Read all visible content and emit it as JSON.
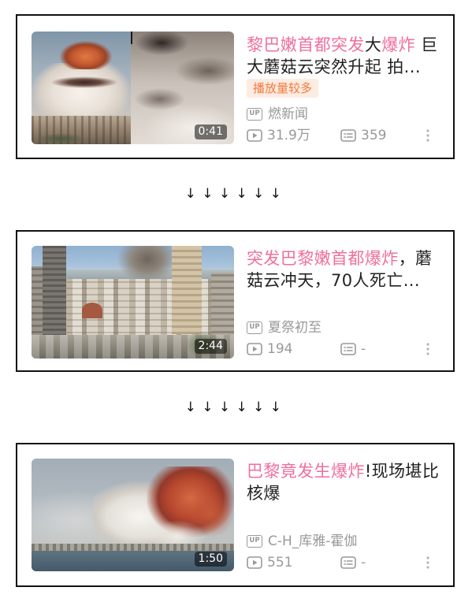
{
  "colors": {
    "background": "#ffffff",
    "card_border": "#111111",
    "title_text": "#222222",
    "keyword_highlight": "#ef6f9d",
    "meta_text": "#999999",
    "badge_text": "#f27a3e",
    "badge_background": "#fdece2"
  },
  "labels": {
    "up": "UP"
  },
  "connector": {
    "glyph": "↓",
    "icon": "down-arrow-icon"
  },
  "icons": {
    "uploader": "up-badge-icon",
    "views": "play-count-icon",
    "danmaku": "danmaku-count-icon",
    "more": "more-options-icon"
  },
  "cards": [
    {
      "title_lines": [
        [
          {
            "text": "黎巴嫩首都突发",
            "hl": true
          },
          {
            "text": "大",
            "hl": false
          },
          {
            "text": "爆炸",
            "hl": true
          },
          {
            "text": " 巨",
            "hl": false
          }
        ],
        [
          {
            "text": "大蘑菇云突然升起 拍...",
            "hl": false
          }
        ]
      ],
      "duration": "0:41",
      "badge": "播放量较多",
      "uploader": "燃新闻",
      "views": "31.9万",
      "danmaku": "359"
    },
    {
      "title_lines": [
        [
          {
            "text": "突发巴黎嫩首都爆炸",
            "hl": true
          },
          {
            "text": "，蘑",
            "hl": false
          }
        ],
        [
          {
            "text": "菇云冲天，70人死亡...",
            "hl": false
          }
        ]
      ],
      "duration": "2:44",
      "uploader": "夏祭初至",
      "views": "194",
      "danmaku": "-"
    },
    {
      "title_lines": [
        [
          {
            "text": "巴黎竟发生爆炸",
            "hl": true
          },
          {
            "text": "!现场堪比",
            "hl": false
          }
        ],
        [
          {
            "text": "核爆",
            "hl": false
          }
        ]
      ],
      "duration": "1:50",
      "uploader": "C-H_库雅-霍伽",
      "views": "551",
      "danmaku": "-"
    }
  ]
}
